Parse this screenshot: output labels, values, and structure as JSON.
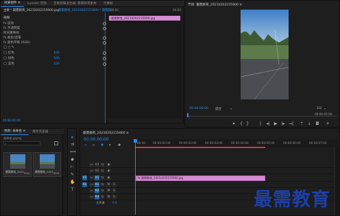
{
  "effect_controls": {
    "tabs": [
      "效果控件 ≡",
      "Lumetri 范围",
      "音频剪辑混合器: 最需教育素材",
      "元数据"
    ],
    "source_label": "主要 * 最需教育_20210202155900.jpg",
    "sequence_label": "最需教育_20210202155900 * 最需教...",
    "timecode": "00:00",
    "timecode_end": "00:00",
    "clip_name": "最需教育_20210202155900.jpg",
    "section": "视频",
    "rows": [
      {
        "label": "fx  运动"
      },
      {
        "label": "fx  不透明度"
      },
      {
        "label": "  时间重映射"
      },
      {
        "label": "fx  裁剪/遮罩"
      },
      {
        "label": "fx  颜色平衡 (RGB)"
      },
      {
        "label": "  ◯  ◻  ✎"
      },
      {
        "label": "  ◯ 红色",
        "value": "100"
      },
      {
        "label": "  ◯ 绿色",
        "value": "100"
      },
      {
        "label": "  ◯ 蓝色",
        "value": "100"
      }
    ],
    "bottom_timecode": "00:00:00:00"
  },
  "program_monitor": {
    "title": "节目: 最需教育_20210202155900 ≡",
    "timecode": "00:00:00:00",
    "fit": "适合",
    "scale": "1/2",
    "duration": "00:00:05:00"
  },
  "project_panel": {
    "tabs": [
      "项目: 未命名 ≡",
      "媒体浏览器"
    ],
    "project_file": "未命名.prproj",
    "search_placeholder": "",
    "items": [
      {
        "name": "最需教育_2021...",
        "duration": "5:00"
      },
      {
        "name": "最需教育_2021...",
        "duration": "5:00"
      }
    ]
  },
  "timeline": {
    "tab": "最需教育_20210202155900 ≡",
    "timecode": "00:00:00:00",
    "ruler": [
      "00:00",
      "00:00:01:00",
      "00:00:02:00",
      "00:00:03:00",
      "00:00:04:00",
      "00:00:05:00",
      "00:00:06:00",
      "00:00:07:00"
    ],
    "video_tracks": [
      "V3",
      "V2",
      "V1"
    ],
    "audio_tracks": [
      "A1",
      "A2",
      "A3"
    ],
    "master_label": "主声道",
    "master_value": "0.0",
    "clip_name": "fx 最需教育_20210202155900.jpg"
  },
  "watermark": "最需教育",
  "colors": {
    "accent_blue": "#2d8ceb",
    "clip_pink": "#d48cd4",
    "playhead_red": "#d23c3c"
  }
}
